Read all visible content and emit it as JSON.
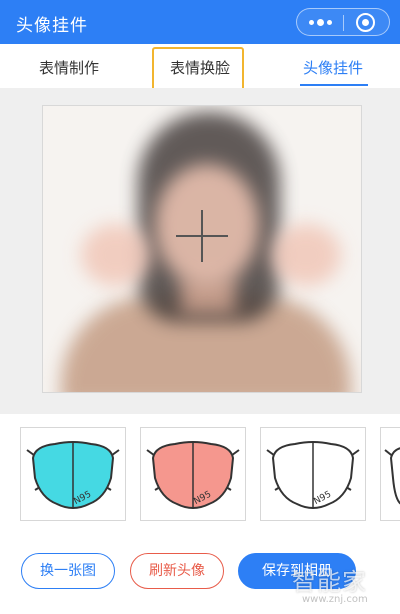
{
  "header": {
    "title": "头像挂件"
  },
  "tabs": [
    {
      "label": "表情制作",
      "active": false
    },
    {
      "label": "表情换脸",
      "active": false,
      "highlighted": true
    },
    {
      "label": "头像挂件",
      "active": true
    }
  ],
  "masks": [
    {
      "label": "N95",
      "color": "#45d9e3"
    },
    {
      "label": "N95",
      "color": "#f5978e"
    },
    {
      "label": "N95",
      "color": "#ffffff"
    }
  ],
  "buttons": {
    "change": "换一张图",
    "refresh": "刷新头像",
    "save": "保存到相册"
  },
  "watermark": {
    "logo": "智能家",
    "url": "www.znj.com"
  },
  "colors": {
    "primary": "#2d7ff5",
    "danger": "#e85c4a",
    "highlight": "#f2b52f"
  }
}
